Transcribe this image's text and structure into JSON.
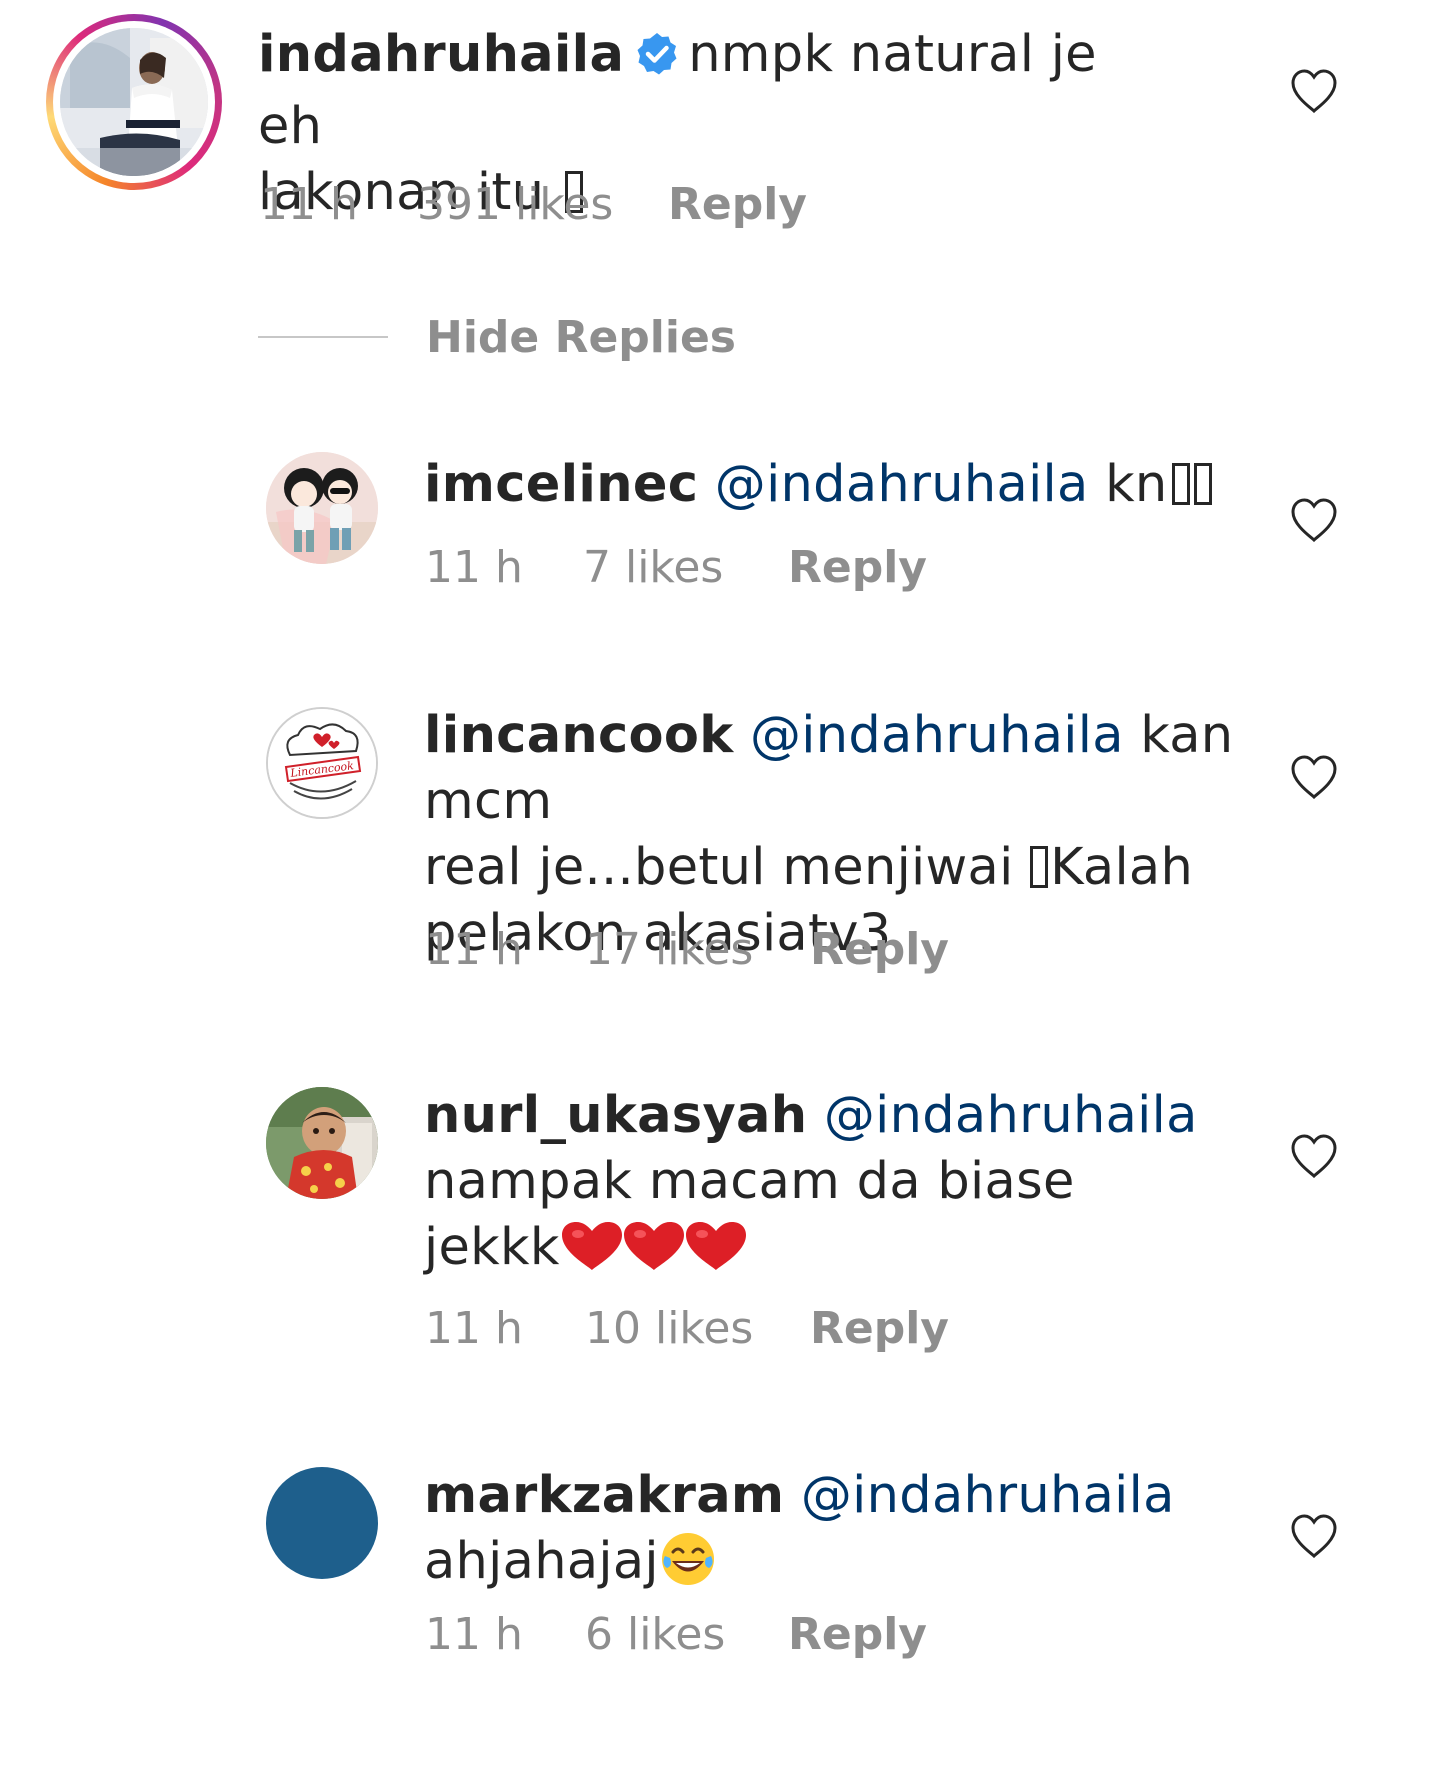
{
  "comments": [
    {
      "username": "indahruhaila",
      "verified": true,
      "mention": "",
      "text_line1": "nmpk natural je eh",
      "text_line2": "lakonan itu ",
      "time": "11 h",
      "likes": "391 likes",
      "reply": "Reply"
    }
  ],
  "hide_replies_label": "Hide Replies",
  "replies": [
    {
      "username": "imcelinec",
      "mention": "@indahruhaila",
      "text": "kn",
      "time": "11 h",
      "likes": "7 likes",
      "reply": "Reply"
    },
    {
      "username": "lincancook",
      "mention": "@indahruhaila",
      "text_line1": "kan mcm",
      "text_line2a": "real je...betul menjiwai ",
      "text_line2b": "Kalah",
      "text_line3": "pelakon akasiatv3",
      "avatar_label": "Lincancook",
      "time": "11 h",
      "likes": "17 likes",
      "reply": "Reply"
    },
    {
      "username": "nurl_ukasyah",
      "mention": "@indahruhaila",
      "text_line1": "nampak macam da biase",
      "text_line2": "jekkk",
      "time": "11 h",
      "likes": "10 likes",
      "reply": "Reply"
    },
    {
      "username": "markzakram",
      "mention": "@indahruhaila",
      "text_line1": "ahjahajaj",
      "time": "11 h",
      "likes": "6 likes",
      "reply": "Reply"
    }
  ],
  "colors": {
    "username": "#262626",
    "mention": "#003569",
    "meta": "#8e8e8e",
    "verified": "#3897f0",
    "markzakram_avatar": "#1e5f8c"
  },
  "icons": {
    "like": "heart-outline-icon",
    "verified": "verified-badge-icon"
  }
}
